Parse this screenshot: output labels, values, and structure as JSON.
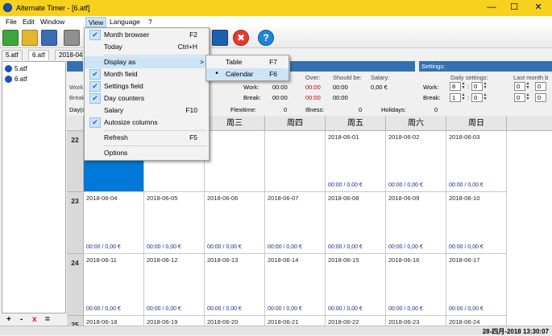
{
  "window": {
    "title": "Alternate Timer - [6.atf]"
  },
  "menubar": [
    "File",
    "Edit",
    "Window",
    "View",
    "Language",
    "?"
  ],
  "tabs": [
    "5.atf",
    "6.atf",
    "2018-04"
  ],
  "tree": [
    "5.atf",
    "6.atf"
  ],
  "bottom_ops": [
    "+",
    "-",
    "x",
    "="
  ],
  "view_menu": [
    {
      "label": "Month browser",
      "shortcut": "F2",
      "checked": true
    },
    {
      "label": "Today",
      "shortcut": "Ctrl+H",
      "checked": false
    },
    {
      "label": "Display as",
      "shortcut": ">",
      "checked": false,
      "highlight": true
    },
    {
      "label": "Month field",
      "shortcut": "",
      "checked": true
    },
    {
      "label": "Settings field",
      "shortcut": "",
      "checked": true
    },
    {
      "label": "Day counters",
      "shortcut": "",
      "checked": true
    },
    {
      "label": "Salary",
      "shortcut": "F10",
      "checked": false
    },
    {
      "label": "Autosize columns",
      "shortcut": "",
      "checked": true
    },
    {
      "label": "Refresh",
      "shortcut": "F5",
      "checked": false
    },
    {
      "label": "Options",
      "shortcut": "",
      "checked": false
    }
  ],
  "submenu": [
    {
      "label": "Table",
      "shortcut": "F7",
      "selected": false
    },
    {
      "label": "Calendar",
      "shortcut": "F6",
      "selected": true
    }
  ],
  "info": {
    "left_label_a": "Work",
    "left_label_b": "Break",
    "col_headers": [
      "Over:",
      "Should be:",
      "Salary:"
    ],
    "work_label": "Work:",
    "break_label": "Break:",
    "work_vals": [
      "00:00",
      "00:00",
      "00:00",
      "0,00 €"
    ],
    "break_vals": [
      "00:00",
      "00:00",
      "00:00"
    ]
  },
  "settings": {
    "title": "Settings:",
    "daily_label": "Daily settings:",
    "last_month_label": "Last month b",
    "work_label": "Work:",
    "break_label": "Break:",
    "work_spin": [
      "8",
      "0"
    ],
    "break_spin": [
      "1",
      "0"
    ],
    "last_spin": [
      "0",
      "0"
    ]
  },
  "counters": {
    "days_label": "Day(s",
    "flexitime_label": "Flexitime:",
    "flexitime_val": "0",
    "illness_label": "Illness:",
    "illness_val": "0",
    "holidays_label": "Holidays:",
    "holidays_val": "0"
  },
  "calendar": {
    "headers": [
      "周三",
      "周四",
      "周五",
      "周六",
      "周日"
    ],
    "weeks": [
      {
        "num": "22",
        "days": [
          "",
          "",
          "",
          "",
          "2018-06-01",
          "2018-06-02",
          "2018-06-03"
        ]
      },
      {
        "num": "23",
        "days": [
          "2018-06-04",
          "2018-06-05",
          "2018-06-06",
          "2018-06-07",
          "2018-06-08",
          "2018-06-09",
          "2018-06-10"
        ]
      },
      {
        "num": "24",
        "days": [
          "2018-06-11",
          "2018-06-12",
          "2018-06-13",
          "2018-06-14",
          "2018-06-15",
          "2018-06-16",
          "2018-06-17"
        ]
      },
      {
        "num": "25",
        "days": [
          "2018-06-18",
          "2018-06-19",
          "2018-06-20",
          "2018-06-21",
          "2018-06-22",
          "2018-06-23",
          "2018-06-24"
        ]
      }
    ],
    "total_text": "00:00 / 0,00 €"
  },
  "status": {
    "datetime": "28-四月-2018 13:30:07"
  },
  "colors": {
    "titlebar": "#f7d11f",
    "accent": "#3570b4",
    "selected": "#0078d7"
  }
}
